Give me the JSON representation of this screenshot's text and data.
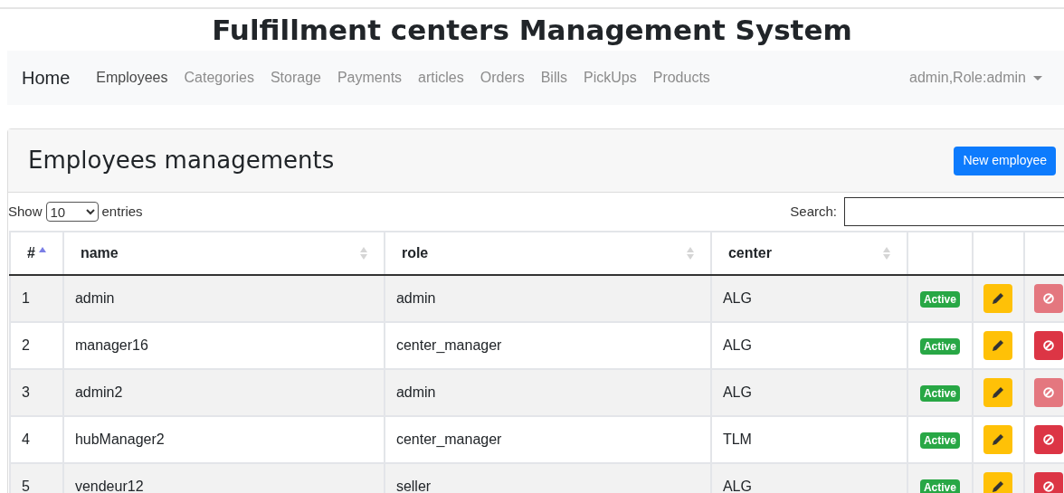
{
  "title": "Fulfillment centers Management System",
  "navbar": {
    "brand": "Home",
    "items": [
      {
        "label": "Employees",
        "selected": true
      },
      {
        "label": "Categories",
        "selected": false
      },
      {
        "label": "Storage",
        "selected": false
      },
      {
        "label": "Payments",
        "selected": false
      },
      {
        "label": "articles",
        "selected": false
      },
      {
        "label": "Orders",
        "selected": false
      },
      {
        "label": "Bills",
        "selected": false
      },
      {
        "label": "PickUps",
        "selected": false
      },
      {
        "label": "Products",
        "selected": false
      }
    ],
    "user_menu": "admin,Role:admin"
  },
  "card": {
    "title": "Employees managements",
    "new_button": "New employee"
  },
  "length": {
    "show": "Show",
    "value": "10",
    "entries": "entries"
  },
  "search": {
    "label": "Search:"
  },
  "table": {
    "columns": [
      {
        "label": "#",
        "sorted": true
      },
      {
        "label": "name",
        "sorted": false
      },
      {
        "label": "role",
        "sorted": false
      },
      {
        "label": "center",
        "sorted": false
      }
    ],
    "rows": [
      {
        "id": "1",
        "name": "admin",
        "role": "admin",
        "center": "ALG",
        "status": "Active",
        "delete_disabled": true
      },
      {
        "id": "2",
        "name": "manager16",
        "role": "center_manager",
        "center": "ALG",
        "status": "Active",
        "delete_disabled": false
      },
      {
        "id": "3",
        "name": "admin2",
        "role": "admin",
        "center": "ALG",
        "status": "Active",
        "delete_disabled": true
      },
      {
        "id": "4",
        "name": "hubManager2",
        "role": "center_manager",
        "center": "TLM",
        "status": "Active",
        "delete_disabled": false
      },
      {
        "id": "5",
        "name": "vendeur12",
        "role": "seller",
        "center": "ALG",
        "status": "Active",
        "delete_disabled": false
      }
    ]
  }
}
